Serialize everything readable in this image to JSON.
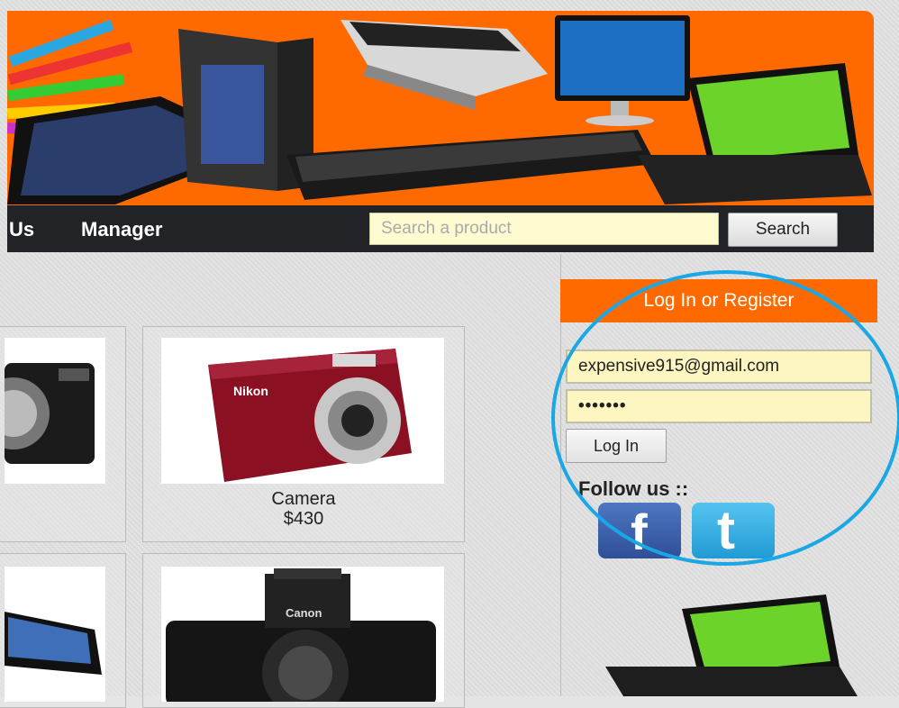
{
  "nav": {
    "items": [
      "Us",
      "Manager"
    ]
  },
  "search": {
    "placeholder": "Search a product",
    "button_label": "Search"
  },
  "products": [
    {
      "name": "Camera",
      "price": "$430",
      "image": "nikon-coolpix-red-camera"
    },
    {
      "name": "",
      "price": "",
      "image": "canon-dslr-camera"
    }
  ],
  "login": {
    "heading": "Log In or Register",
    "email_value": "expensive915@gmail.com",
    "password_value": "•••••••",
    "button_label": "Log In"
  },
  "social": {
    "heading": "Follow us ::",
    "facebook_letter": "f",
    "twitter_letter": "t"
  },
  "colors": {
    "accent": "#ff6a00",
    "navbar": "#222326",
    "highlight_circle": "#1aa7e6"
  }
}
